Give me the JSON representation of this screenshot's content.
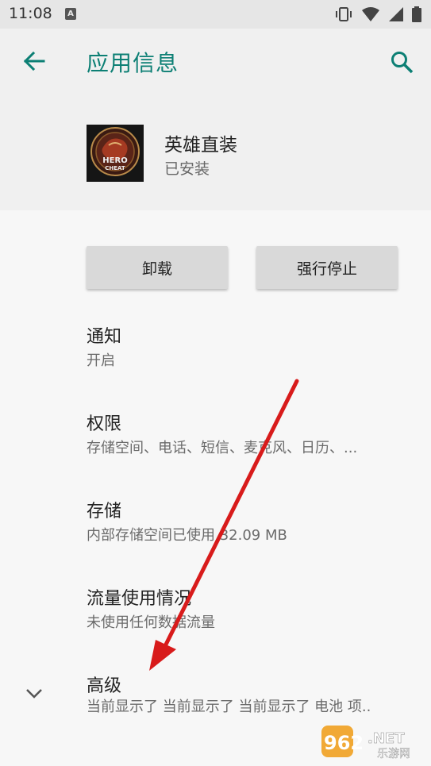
{
  "status_bar": {
    "time": "11:08",
    "notification_icon_letter": "A",
    "icons": [
      "vibrate-icon",
      "wifi-icon",
      "signal-icon",
      "battery-icon"
    ]
  },
  "header": {
    "title": "应用信息",
    "back_icon": "arrow-back-icon",
    "search_icon": "search-icon"
  },
  "app": {
    "name": "英雄直装",
    "status": "已安装",
    "icon_text_line1": "HERO",
    "icon_text_line2": "CHEAT"
  },
  "actions": {
    "uninstall_label": "卸载",
    "force_stop_label": "强行停止"
  },
  "settings": [
    {
      "title": "通知",
      "summary": "开启"
    },
    {
      "title": "权限",
      "summary": "存储空间、电话、短信、麦克风、日历、..."
    },
    {
      "title": "存储",
      "summary": "内部存储空间已使用 32.09 MB"
    },
    {
      "title": "流量使用情况",
      "summary": "未使用任何数据流量"
    },
    {
      "title": "高级",
      "summary": "当前显示了 当前显示了 当前显示了 电池 项.."
    }
  ],
  "watermark": {
    "number": "962",
    "suffix": ".NET",
    "subtitle": "乐游网"
  },
  "colors": {
    "accent": "#0c7f74",
    "annotation_arrow": "#d81b1b"
  }
}
